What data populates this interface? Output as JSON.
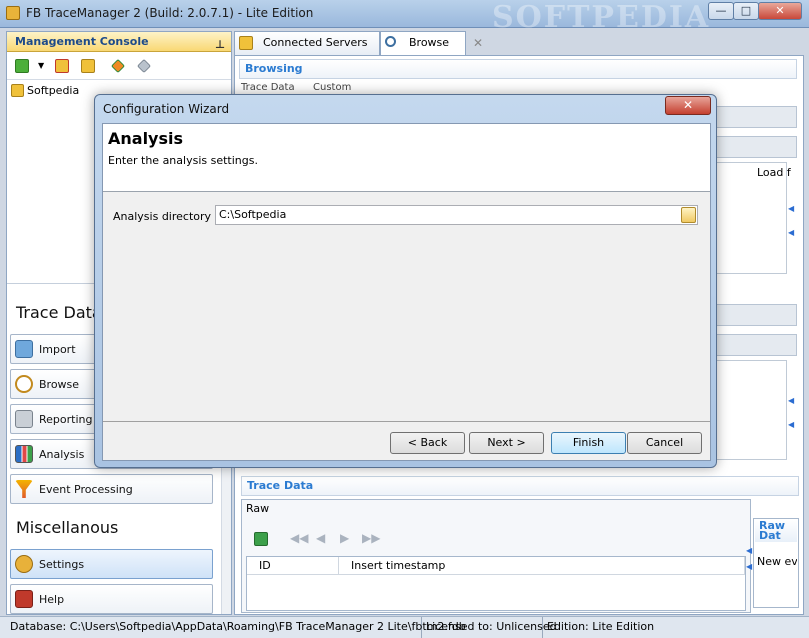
{
  "window": {
    "title": "FB TraceManager 2 (Build: 2.0.7.1) - Lite Edition",
    "watermark": "SOFTPEDIA",
    "buttons": {
      "minimize": "—",
      "maximize": "□",
      "close": "✕"
    }
  },
  "management_console": {
    "header": "Management Console",
    "tree_item": "Softpedia",
    "sections": {
      "trace_data": "Trace Data",
      "miscellaneous": "Miscellanous"
    },
    "nav_items": [
      {
        "label": "Import",
        "icon": "import-icon"
      },
      {
        "label": "Browse",
        "icon": "magnifier-icon"
      },
      {
        "label": "Reporting",
        "icon": "printer-icon"
      },
      {
        "label": "Analysis",
        "icon": "chart-icon"
      },
      {
        "label": "Event Processing",
        "icon": "funnel-icon"
      },
      {
        "label": "Settings",
        "icon": "settings-icon"
      },
      {
        "label": "Help",
        "icon": "book-icon"
      }
    ]
  },
  "tabs": [
    {
      "label": "Connected Servers"
    },
    {
      "label": "Browse"
    }
  ],
  "browse_panel": {
    "header": "Browsing",
    "sub_tabs": [
      "Trace Data",
      "Custom"
    ],
    "load_label": "Load f",
    "trace_data_header": "Trace Data",
    "raw_tab": "Raw",
    "columns": [
      "ID",
      "Insert timestamp"
    ],
    "raw_side_header": "Raw Dat",
    "raw_side_text": "New ev"
  },
  "dialog": {
    "title": "Configuration Wizard",
    "heading": "Analysis",
    "subheading": "Enter the analysis settings.",
    "field_label": "Analysis directory",
    "field_value": "C:\\Softpedia",
    "buttons": {
      "back": "< Back",
      "next": "Next >",
      "finish": "Finish",
      "cancel": "Cancel"
    }
  },
  "statusbar": {
    "database": "Database: C:\\Users\\Softpedia\\AppData\\Roaming\\FB TraceManager 2 Lite\\fbtm2.fdb",
    "license": "Licensed to: Unlicensed",
    "edition": "Edition: Lite Edition"
  }
}
